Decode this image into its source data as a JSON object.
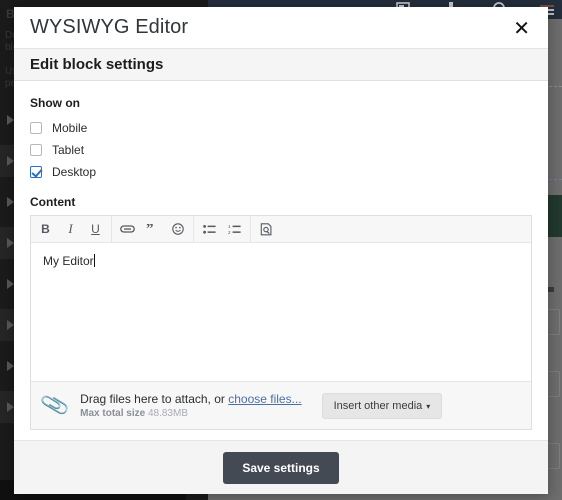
{
  "background": {
    "sidebar": {
      "title": "Block Manager",
      "note_1": "Drag",
      "note_2": "block",
      "note_3": "User",
      "note_4": "perm",
      "rows": [
        {
          "icon": "triangle-right-icon"
        },
        {
          "icon": "triangle-right-icon"
        },
        {
          "icon": "triangle-right-icon"
        },
        {
          "icon": "triangle-right-icon"
        },
        {
          "icon": "triangle-right-icon"
        },
        {
          "icon": "triangle-right-icon"
        },
        {
          "icon": "triangle-right-icon"
        },
        {
          "icon": "triangle-right-icon"
        }
      ]
    },
    "topbar": {
      "icons": [
        "window-icon",
        "anchor-icon",
        "magnifier-icon",
        "hamburger-menu-icon"
      ]
    }
  },
  "modal": {
    "title": "WYSIWYG Editor",
    "close_icon": "close-icon",
    "subheading": "Edit block settings",
    "show_on": {
      "label": "Show on",
      "options": [
        {
          "label": "Mobile",
          "checked": false
        },
        {
          "label": "Tablet",
          "checked": false
        },
        {
          "label": "Desktop",
          "checked": true
        }
      ]
    },
    "content": {
      "label": "Content",
      "toolbar": [
        {
          "name": "bold-icon",
          "glyph": "B"
        },
        {
          "name": "italic-icon",
          "glyph": "I"
        },
        {
          "name": "underline-icon",
          "glyph": "U"
        },
        {
          "name": "link-icon",
          "glyph": "⚭"
        },
        {
          "name": "quote-icon",
          "glyph": "”"
        },
        {
          "name": "emoji-icon",
          "glyph": "☺"
        },
        {
          "name": "bulleted-list-icon",
          "glyph": "☰"
        },
        {
          "name": "numbered-list-icon",
          "glyph": "☰"
        },
        {
          "name": "source-preview-icon",
          "glyph": "⎘"
        }
      ],
      "text": "My Editor"
    },
    "attachments": {
      "clip_icon": "paperclip-icon",
      "drag_text": "Drag files here to attach, or ",
      "choose_link": "choose files...",
      "max_label": "Max total size ",
      "max_size": "48.83MB",
      "media_button": "Insert other media",
      "media_caret": "▾"
    },
    "footer": {
      "save_label": "Save settings"
    }
  },
  "colors": {
    "accent_checkbox": "#2a6fc4",
    "link": "#4a6fa5",
    "save_button": "#434a54",
    "topbar": "#242e3c",
    "sidebar": "#1b1b1b"
  }
}
